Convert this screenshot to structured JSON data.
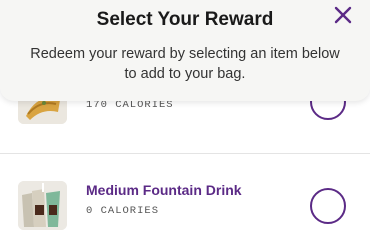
{
  "modal": {
    "title": "Select Your Reward",
    "subtitle": "Redeem your reward by selecting an item below to add to your bag."
  },
  "items": [
    {
      "name": "",
      "calories": "170 CALORIES",
      "selected": false,
      "image": "taco-image"
    },
    {
      "name": "Medium Fountain Drink",
      "calories": "0 CALORIES",
      "selected": false,
      "image": "fountain-drink-image"
    }
  ],
  "colors": {
    "accent": "#5b2a86",
    "header_bg": "#f6f6f4",
    "text": "#1a1a1a"
  }
}
